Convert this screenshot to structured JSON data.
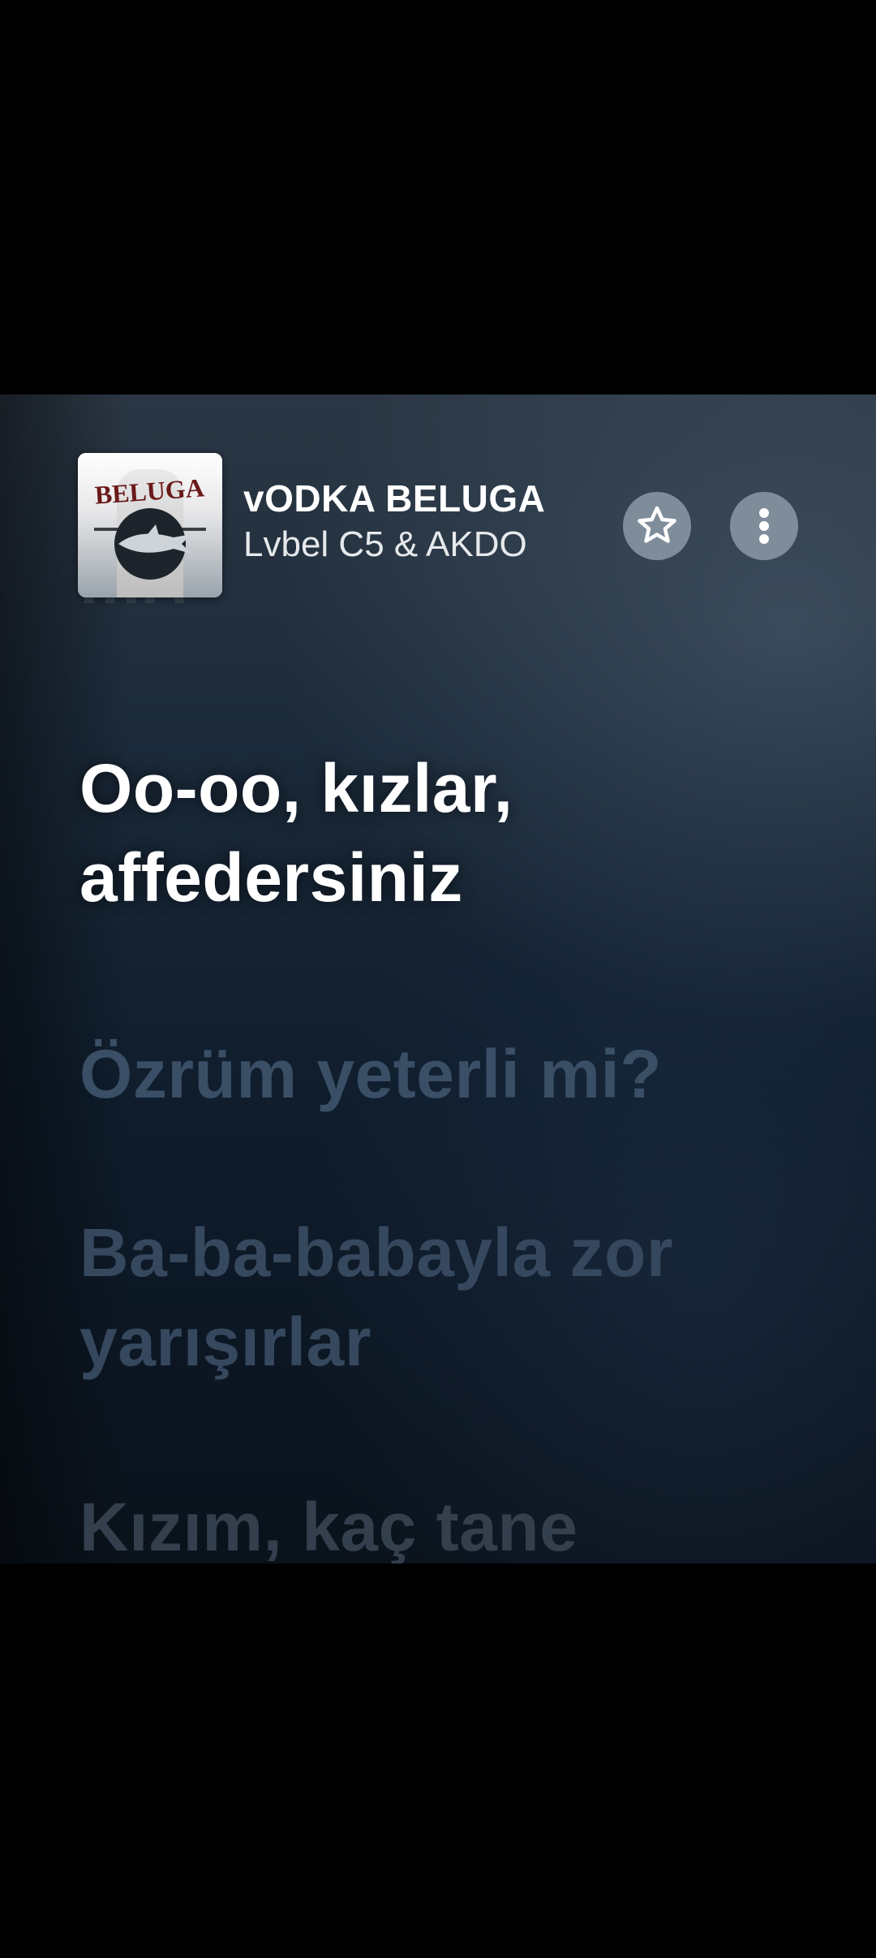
{
  "player": {
    "song_title": "vODKA BELUGA",
    "artist": "Lvbel C5 & AKDO",
    "artwork_text": "BELUGA",
    "icons": {
      "favorite": "star-icon",
      "more": "more-vertical-icon"
    }
  },
  "lyrics": {
    "previous_fragment": "mi?",
    "active_line": [
      "Oo-oo, kızlar,",
      "affedersiniz"
    ],
    "upcoming": [
      [
        "Özrüm yeterli mi?"
      ],
      [
        "Ba-ba-babayla zor",
        "yarışırlar"
      ],
      [
        "Kızım, kaç tane"
      ]
    ]
  },
  "colors": {
    "active_lyric": "#ffffff",
    "upcoming_lyric": "#3a4f66",
    "button_bg": "#7f8d9b",
    "background_top": "#2b3744",
    "background_bottom": "#0a121b"
  }
}
